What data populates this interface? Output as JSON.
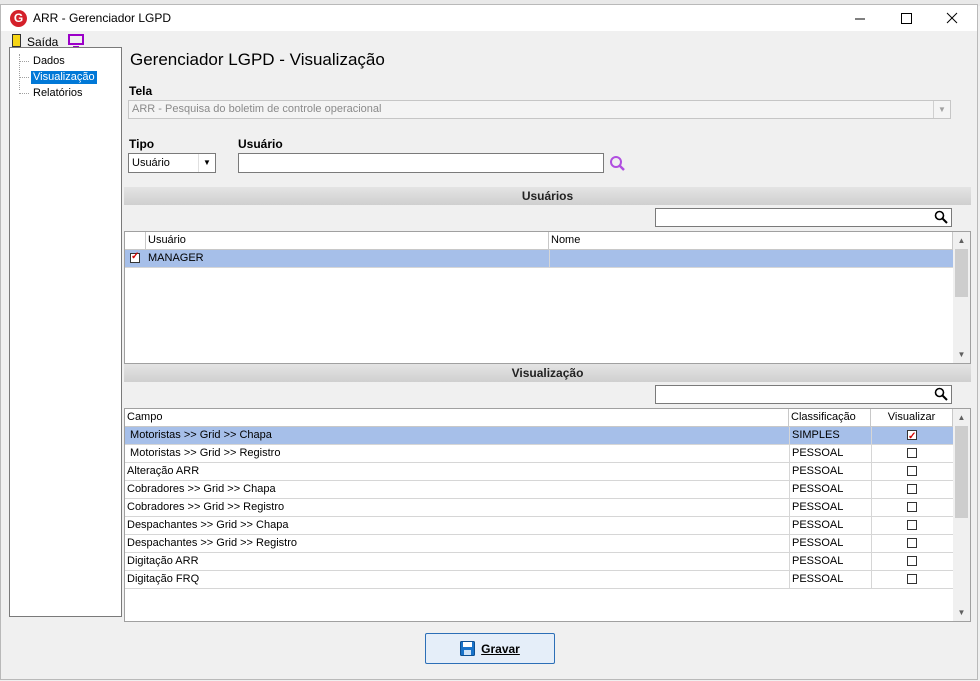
{
  "window": {
    "title": "ARR - Gerenciador LGPD",
    "minimize_symbol": "—",
    "maximize_symbol": "☐",
    "close_symbol": "✕"
  },
  "toolbar": {
    "exit_label": "Saída"
  },
  "tree": {
    "items": [
      {
        "label": "Dados",
        "selected": false
      },
      {
        "label": "Visualização",
        "selected": true
      },
      {
        "label": "Relatórios",
        "selected": false
      }
    ]
  },
  "main": {
    "heading": "Gerenciador LGPD - Visualização",
    "tela_label": "Tela",
    "tela_value": "ARR - Pesquisa do boletim de controle operacional",
    "tipo_label": "Tipo",
    "tipo_value": "Usuário",
    "usuario_label": "Usuário",
    "usuario_value": ""
  },
  "users_section": {
    "title": "Usuários",
    "filter_value": "",
    "columns": [
      "Usuário",
      "Nome"
    ],
    "rows": [
      {
        "checked": true,
        "usuario": "MANAGER",
        "nome": "",
        "selected": true
      }
    ]
  },
  "view_section": {
    "title": "Visualização",
    "filter_value": "",
    "columns": [
      "Campo",
      "Classificação",
      "Visualizar"
    ],
    "rows": [
      {
        "campo": " Motoristas >> Grid >> Chapa",
        "classificacao": "SIMPLES",
        "visualizar": true,
        "selected": true
      },
      {
        "campo": " Motoristas >> Grid >> Registro",
        "classificacao": "PESSOAL",
        "visualizar": false,
        "selected": false
      },
      {
        "campo": "Alteração ARR",
        "classificacao": "PESSOAL",
        "visualizar": false,
        "selected": false
      },
      {
        "campo": "Cobradores >> Grid >> Chapa",
        "classificacao": "PESSOAL",
        "visualizar": false,
        "selected": false
      },
      {
        "campo": "Cobradores >> Grid >> Registro",
        "classificacao": "PESSOAL",
        "visualizar": false,
        "selected": false
      },
      {
        "campo": "Despachantes >> Grid >> Chapa",
        "classificacao": "PESSOAL",
        "visualizar": false,
        "selected": false
      },
      {
        "campo": "Despachantes >> Grid >> Registro",
        "classificacao": "PESSOAL",
        "visualizar": false,
        "selected": false
      },
      {
        "campo": "Digitação ARR",
        "classificacao": "PESSOAL",
        "visualizar": false,
        "selected": false
      },
      {
        "campo": "Digitação FRQ",
        "classificacao": "PESSOAL",
        "visualizar": false,
        "selected": false
      }
    ]
  },
  "footer": {
    "save_label": "Gravar"
  },
  "colors": {
    "selection": "#a6bfe9",
    "accent": "#0078d7",
    "brand": "#d4202a"
  },
  "icons": [
    "app-logo-icon",
    "exit-door-icon",
    "monitor-icon",
    "search-icon",
    "magnifier-icon",
    "floppy-disk-icon"
  ]
}
